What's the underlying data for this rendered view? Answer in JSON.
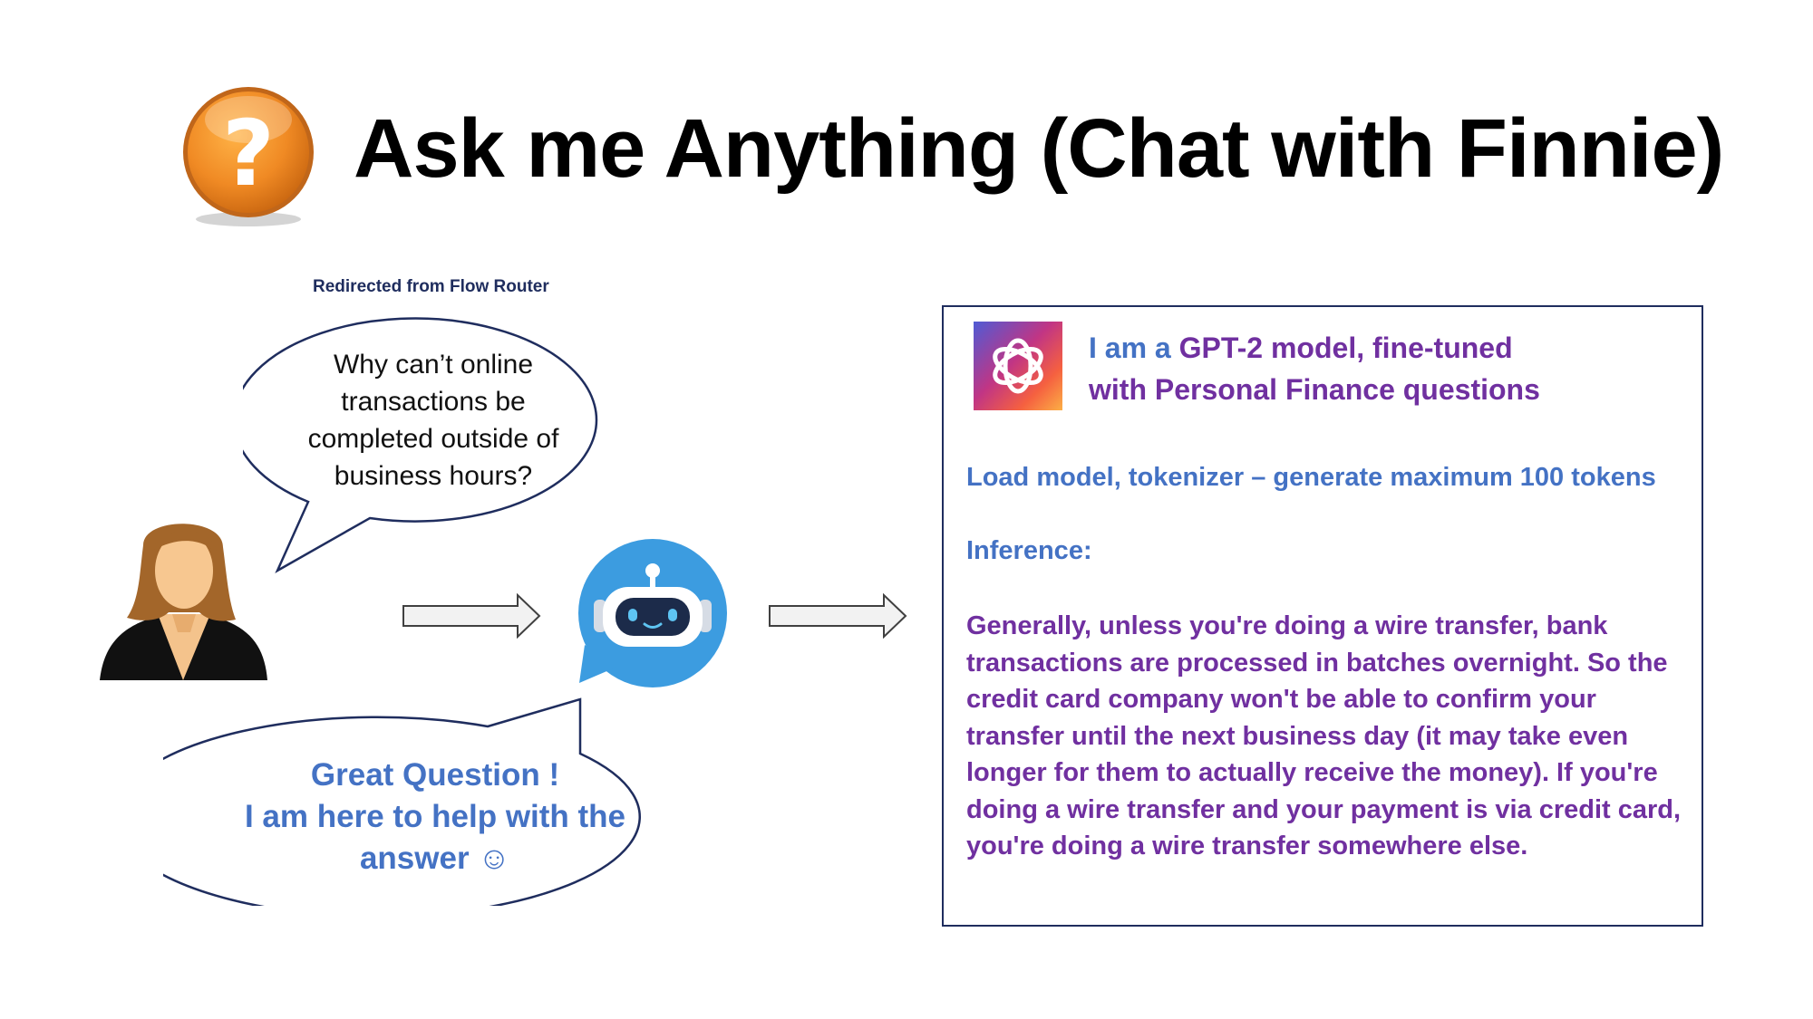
{
  "header": {
    "title": "Ask me Anything (Chat with Finnie)",
    "icon": "question-mark-icon"
  },
  "caption": "Redirected from Flow Router",
  "user_bubble": {
    "text": "Why can’t online transactions be completed outside of business hours?"
  },
  "bot_bubble": {
    "line1": "Great Question !",
    "line2": "I am here to help with the",
    "line3": "answer ☺"
  },
  "panel": {
    "heading_part1": "I am a ",
    "heading_part2": "GPT-2 model, fine-tuned",
    "heading_part3": "with Personal Finance questions",
    "load_line": "Load model, tokenizer – generate maximum 100 tokens",
    "inference_label": "Inference:",
    "answer": "Generally, unless you're doing a wire transfer, bank transactions are processed in batches overnight. So the credit card company won't be able to confirm your transfer until the next business day (it may take even longer for them to actually receive the money). If you're doing a wire transfer and your payment is via credit card, you're doing a wire transfer somewhere else."
  },
  "colors": {
    "orange": "#f08a24",
    "blue_text": "#4472c4",
    "purple_text": "#7030a0",
    "navy": "#1f2d5e",
    "bot_blue": "#3c9ce0"
  }
}
